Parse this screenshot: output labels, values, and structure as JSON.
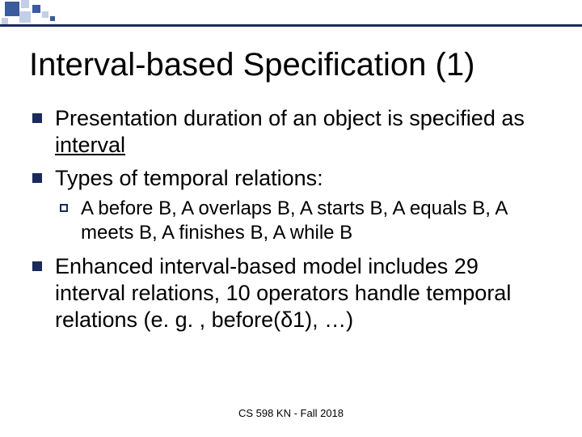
{
  "title": "Interval-based Specification (1)",
  "bullets": {
    "b1_pre": "Presentation duration of an object is specified as ",
    "b1_underlined": "interval",
    "b2": "Types of temporal relations:",
    "b2_sub": "A before B, A overlaps B, A starts B, A equals B, A meets B, A finishes B, A while B",
    "b3": "Enhanced interval-based model includes 29 interval relations, 10 operators handle temporal relations (e. g. , before(δ1), …)"
  },
  "footer": "CS 598 KN - Fall 2018"
}
